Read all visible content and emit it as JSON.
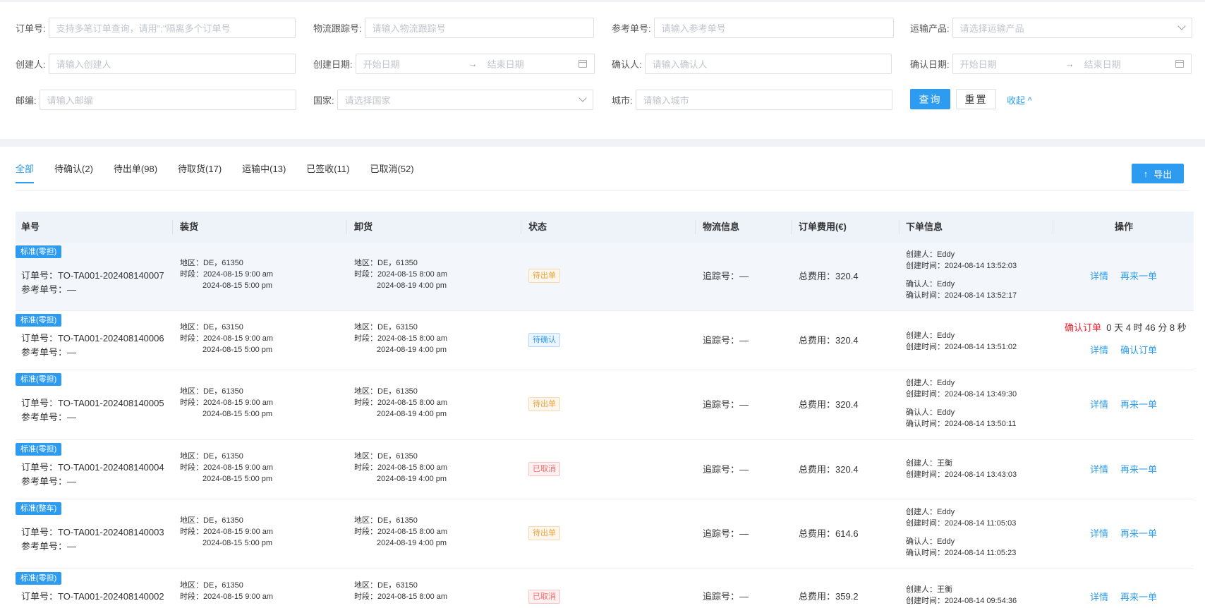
{
  "filters": {
    "order_no": {
      "label": "订单号:",
      "placeholder": "支持多笔订单查询，请用\";\"隔离多个订单号"
    },
    "tracking_no": {
      "label": "物流跟踪号:",
      "placeholder": "请输入物流跟踪号"
    },
    "ref_no": {
      "label": "参考单号:",
      "placeholder": "请输入参考单号"
    },
    "product": {
      "label": "运输产品:",
      "placeholder": "请选择运输产品"
    },
    "creator": {
      "label": "创建人:",
      "placeholder": "请输入创建人"
    },
    "create_date": {
      "label": "创建日期:",
      "start": "开始日期",
      "end": "结束日期"
    },
    "confirmer": {
      "label": "确认人:",
      "placeholder": "请输入确认人"
    },
    "confirm_date": {
      "label": "确认日期:",
      "start": "开始日期",
      "end": "结束日期"
    },
    "zip": {
      "label": "邮编:",
      "placeholder": "请输入邮编"
    },
    "country": {
      "label": "国家:",
      "placeholder": "请选择国家"
    },
    "city": {
      "label": "城市:",
      "placeholder": "请输入城市"
    },
    "query_label": "查询",
    "reset_label": "重置",
    "collapse_label": "收起 ^",
    "range_sep": "→"
  },
  "tabs": [
    {
      "label": "全部",
      "active": true
    },
    {
      "label": "待确认(2)"
    },
    {
      "label": "待出单(98)"
    },
    {
      "label": "待取货(17)"
    },
    {
      "label": "运输中(13)"
    },
    {
      "label": "已签收(11)"
    },
    {
      "label": "已取消(52)"
    }
  ],
  "export_label": "导出",
  "export_arrow": "↑",
  "columns": [
    "单号",
    "装货",
    "卸货",
    "状态",
    "物流信息",
    "订单费用(€)",
    "下单信息",
    "操作"
  ],
  "labels": {
    "order_no": "订单号：",
    "ref_no": "参考单号：",
    "region": "地区：",
    "period": "时段：",
    "tracking": "追踪号：",
    "total": "总费用：",
    "creator": "创建人：",
    "create_time": "创建时间：",
    "confirmer": "确认人：",
    "confirm_time": "确认时间："
  },
  "rows": [
    {
      "tag": "标准(零担)",
      "order_no": "TO-TA001-202408140007",
      "ref_no": "—",
      "load_region": "DE，61350",
      "load_t1": "2024-08-15 9:00 am",
      "load_t2": "2024-08-15 5:00 pm",
      "unload_region": "DE，61350",
      "unload_t1": "2024-08-15 8:00 am",
      "unload_t2": "2024-08-19 4:00 pm",
      "status": "待出单",
      "tracking": "—",
      "total": "320.4",
      "creator": "Eddy",
      "create_time": "2024-08-14 13:52:03",
      "confirmer": "Eddy",
      "confirm_time": "2024-08-14 13:52:17",
      "op1": "详情",
      "op2": "再来一单"
    },
    {
      "tag": "标准(零担)",
      "order_no": "TO-TA001-202408140006",
      "ref_no": "—",
      "load_region": "DE，63150",
      "load_t1": "2024-08-15 9:00 am",
      "load_t2": "2024-08-15 5:00 pm",
      "unload_region": "DE，63150",
      "unload_t1": "2024-08-15 8:00 am",
      "unload_t2": "2024-08-19 4:00 pm",
      "status": "待确认",
      "tracking": "—",
      "total": "320.4",
      "creator": "Eddy",
      "create_time": "2024-08-14 13:51:02",
      "countdown_label": "确认订单",
      "countdown": "0 天 4 时 46 分 8 秒",
      "op1": "详情",
      "op2": "确认订单"
    },
    {
      "tag": "标准(零担)",
      "order_no": "TO-TA001-202408140005",
      "ref_no": "—",
      "load_region": "DE，61350",
      "load_t1": "2024-08-15 9:00 am",
      "load_t2": "2024-08-15 5:00 pm",
      "unload_region": "DE，61350",
      "unload_t1": "2024-08-15 8:00 am",
      "unload_t2": "2024-08-19 4:00 pm",
      "status": "待出单",
      "tracking": "—",
      "total": "320.4",
      "creator": "Eddy",
      "create_time": "2024-08-14 13:49:30",
      "confirmer": "Eddy",
      "confirm_time": "2024-08-14 13:50:11",
      "op1": "详情",
      "op2": "再来一单"
    },
    {
      "tag": "标准(零担)",
      "order_no": "TO-TA001-202408140004",
      "ref_no": "—",
      "load_region": "DE，61350",
      "load_t1": "2024-08-15 9:00 am",
      "load_t2": "2024-08-15 5:00 pm",
      "unload_region": "DE，61350",
      "unload_t1": "2024-08-15 8:00 am",
      "unload_t2": "2024-08-19 4:00 pm",
      "status": "已取消",
      "tracking": "—",
      "total": "320.4",
      "creator": "王衡",
      "create_time": "2024-08-14 13:43:03",
      "op1": "详情",
      "op2": "再来一单"
    },
    {
      "tag": "标准(整车)",
      "order_no": "TO-TA001-202408140003",
      "ref_no": "—",
      "load_region": "DE，61350",
      "load_t1": "2024-08-15 9:00 am",
      "load_t2": "2024-08-15 5:00 pm",
      "unload_region": "DE，61350",
      "unload_t1": "2024-08-15 8:00 am",
      "unload_t2": "2024-08-19 4:00 pm",
      "status": "待出单",
      "tracking": "—",
      "total": "614.6",
      "creator": "Eddy",
      "create_time": "2024-08-14 11:05:03",
      "confirmer": "Eddy",
      "confirm_time": "2024-08-14 11:05:23",
      "op1": "详情",
      "op2": "再来一单"
    },
    {
      "tag": "标准(零担)",
      "order_no": "TO-TA001-202408140002",
      "ref_no": "—",
      "load_region": "DE，61350",
      "load_t1": "2024-08-15 9:00 am",
      "unload_region": "DE，63150",
      "unload_t1": "2024-08-15 8:00 am",
      "status": "已取消",
      "tracking": "—",
      "total": "359.2",
      "creator": "王衡",
      "create_time": "2024-08-14 09:54:36",
      "op1": "详情",
      "op2": "再来一单"
    }
  ]
}
